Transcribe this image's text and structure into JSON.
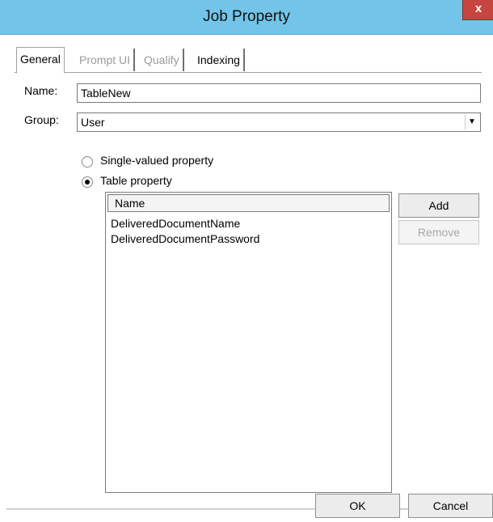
{
  "window": {
    "title": "Job Property",
    "close_glyph": "x"
  },
  "tabs": [
    {
      "label": "General",
      "state": "active"
    },
    {
      "label": "Prompt UI",
      "state": "disabled"
    },
    {
      "label": "Qualify",
      "state": "disabled"
    },
    {
      "label": "Indexing",
      "state": "enabled"
    }
  ],
  "form": {
    "name_label": "Name:",
    "name_value": "TableNew",
    "group_label": "Group:",
    "group_value": "User",
    "dropdown_glyph": "▼"
  },
  "property_type": {
    "single_label": "Single-valued property",
    "table_label": "Table property",
    "selected": "table"
  },
  "table": {
    "header": "Name",
    "rows": [
      "DeliveredDocumentName",
      "DeliveredDocumentPassword"
    ]
  },
  "buttons": {
    "add": "Add",
    "remove": "Remove",
    "ok": "OK",
    "cancel": "Cancel"
  }
}
